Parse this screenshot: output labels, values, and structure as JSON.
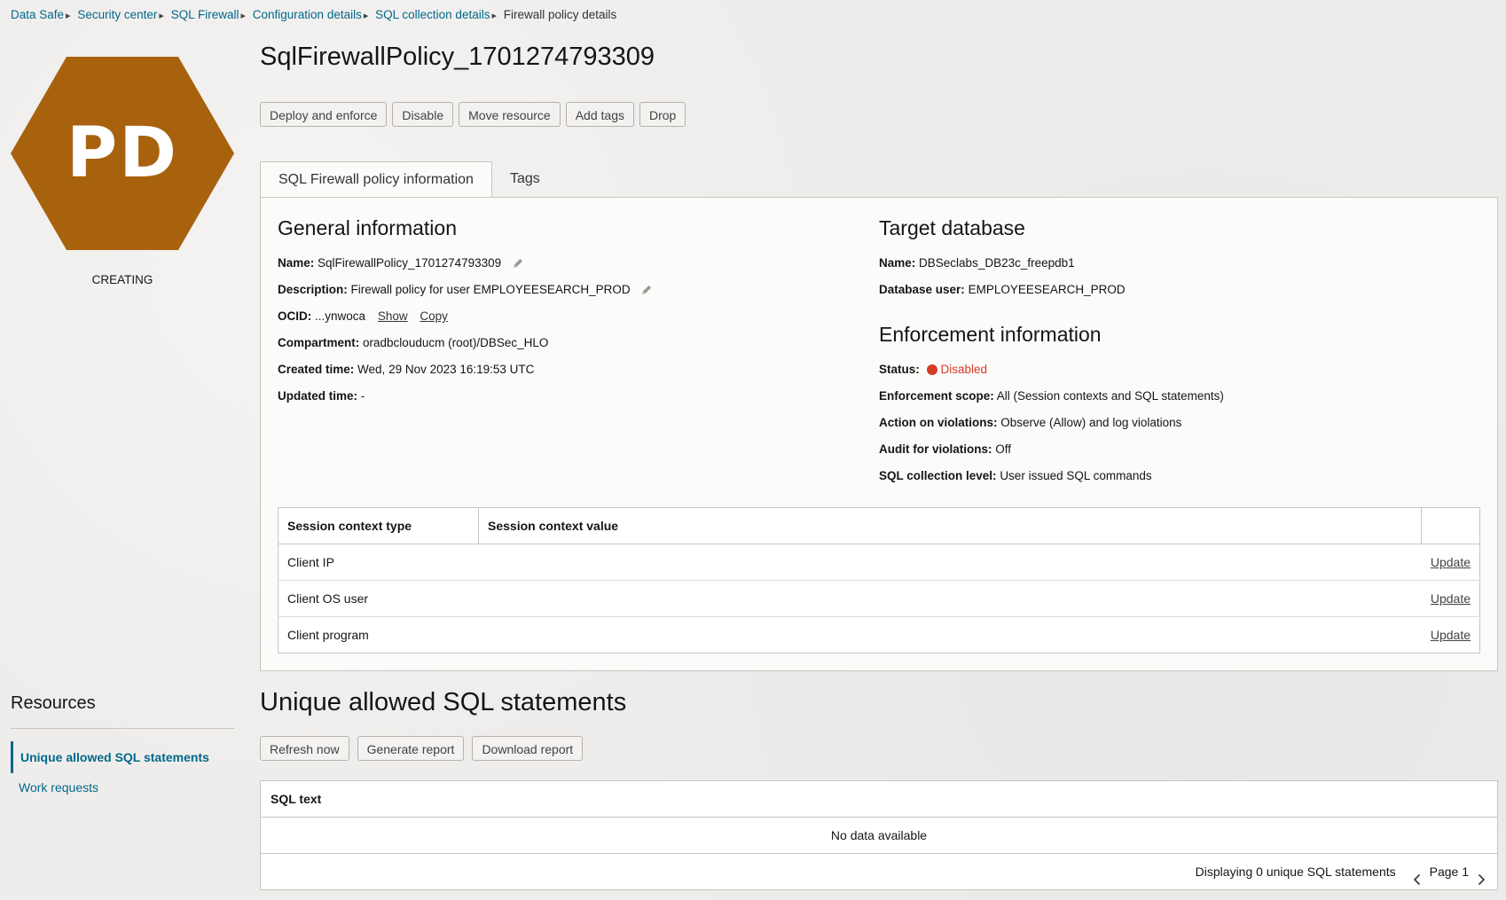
{
  "breadcrumb": {
    "items": [
      "Data Safe",
      "Security center",
      "SQL Firewall",
      "Configuration details",
      "SQL collection details"
    ],
    "current": "Firewall policy details"
  },
  "badge": {
    "initials": "PD",
    "color": "#a8620e",
    "state": "CREATING"
  },
  "resources": {
    "title": "Resources",
    "items": [
      "Unique allowed SQL statements",
      "Work requests"
    ]
  },
  "page": {
    "title": "SqlFirewallPolicy_1701274793309"
  },
  "actions": [
    "Deploy and enforce",
    "Disable",
    "Move resource",
    "Add tags",
    "Drop"
  ],
  "tabs": [
    "SQL Firewall policy information",
    "Tags"
  ],
  "general": {
    "title": "General information",
    "name_label": "Name:",
    "name_value": "SqlFirewallPolicy_1701274793309",
    "desc_label": "Description:",
    "desc_value": "Firewall policy for user EMPLOYEESEARCH_PROD",
    "ocid_label": "OCID:",
    "ocid_value": "...ynwoca",
    "ocid_show": "Show",
    "ocid_copy": "Copy",
    "comp_label": "Compartment:",
    "comp_value": "oradbclouducm (root)/DBSec_HLO",
    "created_label": "Created time:",
    "created_value": "Wed, 29 Nov 2023 16:19:53 UTC",
    "updated_label": "Updated time:",
    "updated_value": "-"
  },
  "target": {
    "title": "Target database",
    "name_label": "Name:",
    "name_value": "DBSeclabs_DB23c_freepdb1",
    "user_label": "Database user:",
    "user_value": "EMPLOYEESEARCH_PROD"
  },
  "enforcement": {
    "title": "Enforcement information",
    "status_label": "Status:",
    "status_value": "Disabled",
    "status_color": "#d63b25",
    "scope_label": "Enforcement scope:",
    "scope_value": "All (Session contexts and SQL statements)",
    "action_label": "Action on violations:",
    "action_value": "Observe (Allow) and log violations",
    "audit_label": "Audit for violations:",
    "audit_value": "Off",
    "level_label": "SQL collection level:",
    "level_value": "User issued SQL commands"
  },
  "context_table": {
    "headers": [
      "Session context type",
      "Session context value"
    ],
    "rows": [
      {
        "type": "Client IP",
        "value": "",
        "action": "Update"
      },
      {
        "type": "Client OS user",
        "value": "",
        "action": "Update"
      },
      {
        "type": "Client program",
        "value": "",
        "action": "Update"
      }
    ]
  },
  "unique_sql": {
    "title": "Unique allowed SQL statements",
    "buttons": [
      "Refresh now",
      "Generate report",
      "Download report"
    ],
    "column": "SQL text",
    "empty": "No data available",
    "footer": "Displaying 0 unique SQL statements",
    "page": "Page 1"
  }
}
